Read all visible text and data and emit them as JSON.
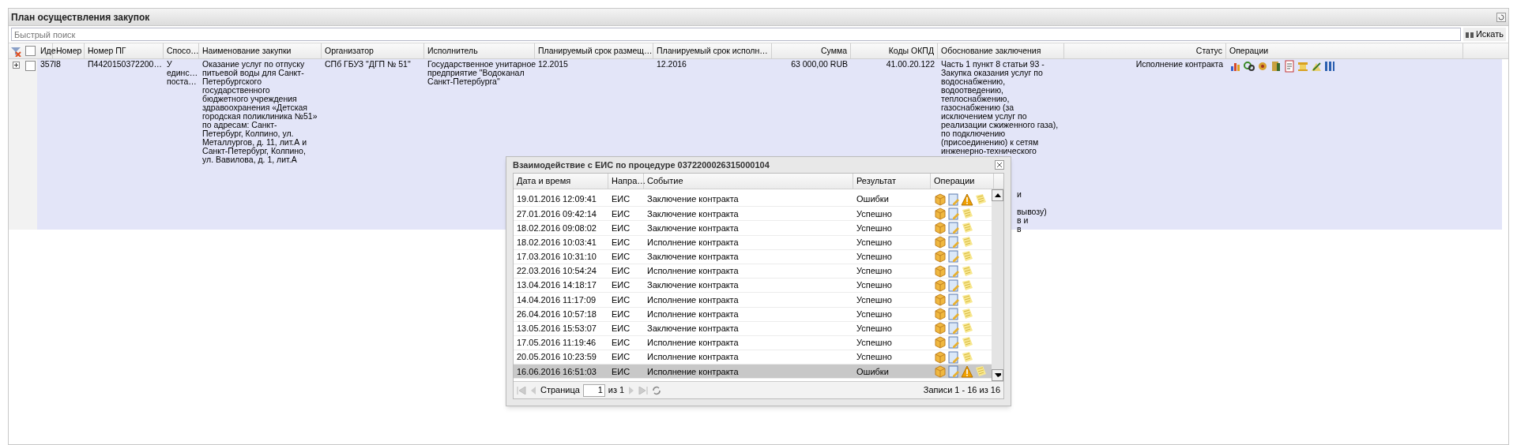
{
  "panel": {
    "title": "План осуществления закупок"
  },
  "search": {
    "placeholder": "Быстрый поиск",
    "button": "Искать"
  },
  "grid": {
    "columns": [
      "Иде",
      "Номер",
      "Номер ПГ",
      "Спосо…",
      "Наименование закупки",
      "Организатор",
      "Исполнитель",
      "Планируемый срок размещ…",
      "Планируемый срок исполн…",
      "Сумма",
      "Коды ОКПД",
      "Обоснование заключения",
      "Статус",
      "Операции"
    ],
    "header_checked": false,
    "rows": [
      {
        "expanded": false,
        "checked": false,
        "cells": [
          {
            "lines": [
              "357l"
            ]
          },
          {
            "lines": [
              "8"
            ]
          },
          {
            "lines": [
              "П4420150372200…"
            ]
          },
          {
            "lines": [
              "У",
              "единс…",
              "поста…"
            ]
          },
          {
            "lines": [
              "Оказание услуг по отпуску",
              "питьевой воды для Санкт-",
              "Петербургского",
              "государственного",
              "бюджетного учреждения",
              "здравоохранения «Детская",
              "городская поликлиника №51»",
              "по адресам: Санкт-",
              "Петербург, Колпино, ул.",
              "Металлургов, д. 11, лит.А и",
              "Санкт-Петербург, Колпино,",
              "ул. Вавилова, д. 1, лит.А"
            ]
          },
          {
            "lines": [
              "СПб ГБУЗ \"ДГП № 51\""
            ]
          },
          {
            "lines": [
              "Государственное унитарное",
              "предприятие \"Водоканал",
              "Санкт-Петербурга\""
            ]
          },
          {
            "lines": [
              "12.2015"
            ]
          },
          {
            "lines": [
              "12.2016"
            ]
          },
          {
            "lines": [
              "63 000,00 RUB"
            ]
          },
          {
            "lines": [
              "41.00.20.122"
            ]
          },
          {
            "lines": [
              "Часть 1 пункт 8 статьи 93 -",
              "Закупка оказания услуг по",
              "водоснабжению,",
              "водоотведению,",
              "теплоснабжению,",
              "газоснабжению (за",
              "исключением услуг по",
              "реализации сжиженного газа),",
              "по подключению",
              "(присоединению) к сетям",
              "инженерно-технического"
            ],
            "fragments": [
              "и",
              "вывозу)",
              "в и",
              "в"
            ]
          },
          {
            "lines": [
              "Исполнение контракта"
            ]
          }
        ]
      }
    ]
  },
  "dialog": {
    "title": "Взаимодействие с ЕИС по процедуре 0372200026315000104",
    "columns": [
      "Дата и время",
      "Напра…",
      "Событие",
      "Результат",
      "Операции"
    ],
    "rows": [
      {
        "date": "19.01.2016 12:09:41",
        "dir": "ЕИС",
        "event": "Заключение контракта",
        "result": "Ошибки",
        "error": true,
        "selected": false
      },
      {
        "date": "27.01.2016 09:42:14",
        "dir": "ЕИС",
        "event": "Заключение контракта",
        "result": "Успешно",
        "error": false,
        "selected": false
      },
      {
        "date": "18.02.2016 09:08:02",
        "dir": "ЕИС",
        "event": "Заключение контракта",
        "result": "Успешно",
        "error": false,
        "selected": false
      },
      {
        "date": "18.02.2016 10:03:41",
        "dir": "ЕИС",
        "event": "Исполнение контракта",
        "result": "Успешно",
        "error": false,
        "selected": false
      },
      {
        "date": "17.03.2016 10:31:10",
        "dir": "ЕИС",
        "event": "Заключение контракта",
        "result": "Успешно",
        "error": false,
        "selected": false
      },
      {
        "date": "22.03.2016 10:54:24",
        "dir": "ЕИС",
        "event": "Исполнение контракта",
        "result": "Успешно",
        "error": false,
        "selected": false
      },
      {
        "date": "13.04.2016 14:18:17",
        "dir": "ЕИС",
        "event": "Заключение контракта",
        "result": "Успешно",
        "error": false,
        "selected": false
      },
      {
        "date": "14.04.2016 11:17:09",
        "dir": "ЕИС",
        "event": "Исполнение контракта",
        "result": "Успешно",
        "error": false,
        "selected": false
      },
      {
        "date": "26.04.2016 10:57:18",
        "dir": "ЕИС",
        "event": "Исполнение контракта",
        "result": "Успешно",
        "error": false,
        "selected": false
      },
      {
        "date": "13.05.2016 15:53:07",
        "dir": "ЕИС",
        "event": "Заключение контракта",
        "result": "Успешно",
        "error": false,
        "selected": false
      },
      {
        "date": "17.05.2016 11:19:46",
        "dir": "ЕИС",
        "event": "Исполнение контракта",
        "result": "Успешно",
        "error": false,
        "selected": false
      },
      {
        "date": "20.05.2016 10:23:59",
        "dir": "ЕИС",
        "event": "Исполнение контракта",
        "result": "Успешно",
        "error": false,
        "selected": false
      },
      {
        "date": "16.06.2016 16:51:03",
        "dir": "ЕИС",
        "event": "Исполнение контракта",
        "result": "Ошибки",
        "error": true,
        "selected": true
      }
    ],
    "pager": {
      "page_label": "Страница",
      "page": "1",
      "of": "из 1",
      "records": "Записи 1 - 16 из 16"
    }
  }
}
